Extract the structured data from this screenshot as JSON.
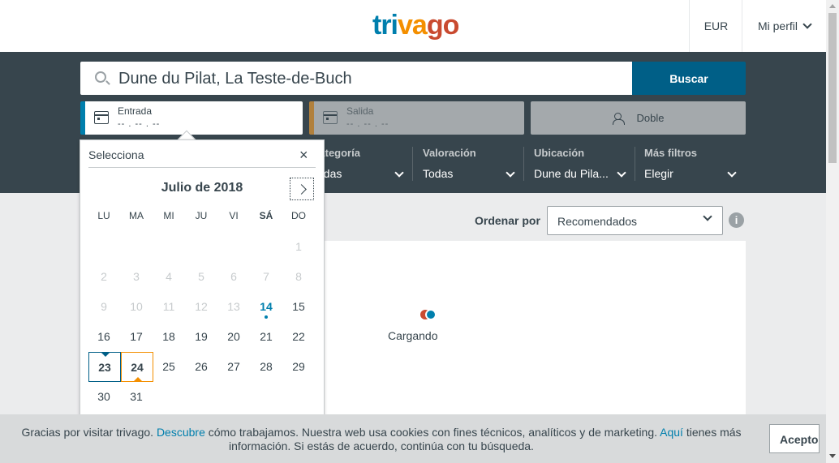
{
  "header": {
    "logo": {
      "part1": "tri",
      "part2": "va",
      "part3": "go"
    },
    "currency": "EUR",
    "profile": "Mi perfil"
  },
  "search": {
    "query": "Dune du Pilat, La Teste-de-Buch",
    "button": "Buscar",
    "checkin": {
      "label": "Entrada",
      "value": "-- . -- . --"
    },
    "checkout": {
      "label": "Salida",
      "value": "-- . -- . --"
    },
    "room": "Doble"
  },
  "filters": [
    {
      "label": "Categoría",
      "value": "Todas"
    },
    {
      "label": "Valoración",
      "value": "Todas"
    },
    {
      "label": "Ubicación",
      "value": "Dune du Pila..."
    },
    {
      "label": "Más filtros",
      "value": "Elegir"
    }
  ],
  "sort": {
    "label": "Ordenar por",
    "value": "Recomendados",
    "info": "i"
  },
  "results": {
    "loading": "Cargando"
  },
  "calendar": {
    "title": "Selecciona",
    "close": "×",
    "month": "Julio de 2018",
    "weekdays": [
      "LU",
      "MA",
      "MI",
      "JU",
      "VI",
      "SÁ",
      "DO"
    ],
    "days": {
      "d1": "1",
      "d2": "2",
      "d3": "3",
      "d4": "4",
      "d5": "5",
      "d6": "6",
      "d7": "7",
      "d8": "8",
      "d9": "9",
      "d10": "10",
      "d11": "11",
      "d12": "12",
      "d13": "13",
      "d14": "14",
      "d15": "15",
      "d16": "16",
      "d17": "17",
      "d18": "18",
      "d19": "19",
      "d20": "20",
      "d21": "21",
      "d22": "22",
      "d23": "23",
      "d24": "24",
      "d25": "25",
      "d26": "26",
      "d27": "27",
      "d28": "28",
      "d29": "29",
      "d30": "30",
      "d31": "31"
    }
  },
  "cookie": {
    "t1": "Gracias por visitar trivago. ",
    "link1": "Descubre",
    "t2": " cómo trabajamos. Nuestra web usa cookies con fines técnicos, analíticos y de marketing. ",
    "link2": "Aquí",
    "t3": " tienes más información. Si estás de acuerdo, continúa con tu búsqueda.",
    "accept": "Acepto"
  }
}
